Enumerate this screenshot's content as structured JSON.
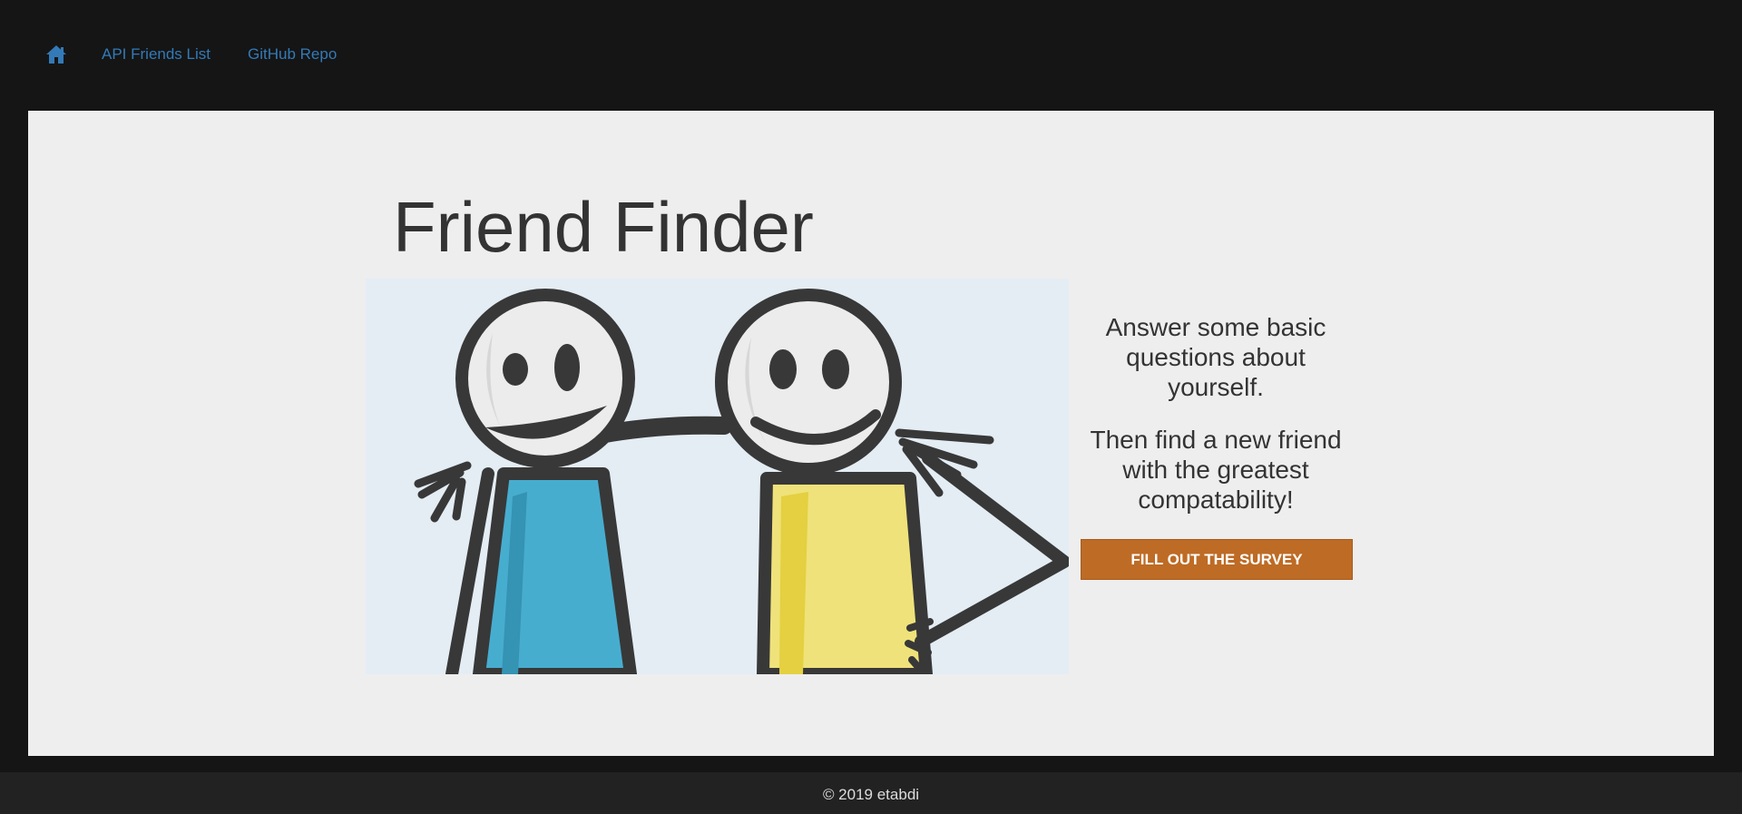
{
  "nav": {
    "home_icon": "home-icon",
    "links": [
      {
        "label": "API Friends List"
      },
      {
        "label": "GitHub Repo"
      }
    ]
  },
  "hero": {
    "title": "Friend Finder",
    "image": "two-stick-figure-friends-illustration",
    "tagline_1": "Answer some basic questions about yourself.",
    "tagline_2": "Then find a new friend with the greatest compatability!",
    "cta_label": "Fill out the survey"
  },
  "footer": {
    "text": "© 2019 etabdi"
  },
  "colors": {
    "nav_background": "#151515",
    "link": "#337ab7",
    "jumbotron": "#eeeeee",
    "button": "#be6b25",
    "footer_background": "#222222"
  }
}
